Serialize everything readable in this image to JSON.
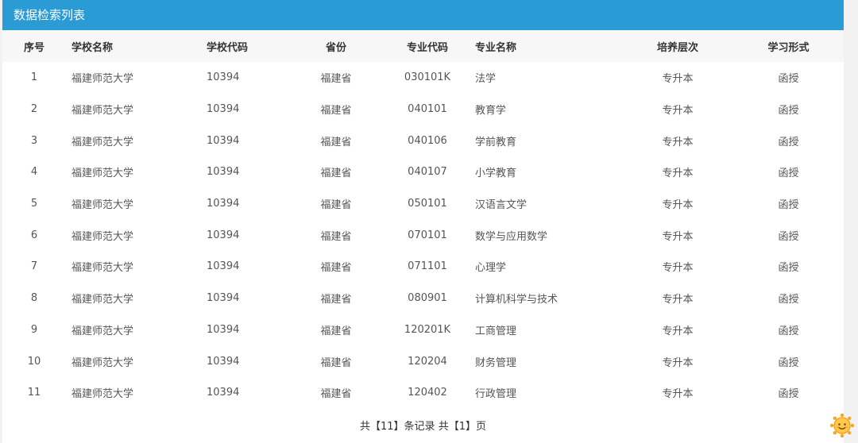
{
  "header": {
    "title": "数据检索列表"
  },
  "table": {
    "columns": [
      "序号",
      "学校名称",
      "学校代码",
      "省份",
      "专业代码",
      "专业名称",
      "培养层次",
      "学习形式"
    ],
    "rows": [
      [
        "1",
        "福建师范大学",
        "10394",
        "福建省",
        "030101K",
        "法学",
        "专升本",
        "函授"
      ],
      [
        "2",
        "福建师范大学",
        "10394",
        "福建省",
        "040101",
        "教育学",
        "专升本",
        "函授"
      ],
      [
        "3",
        "福建师范大学",
        "10394",
        "福建省",
        "040106",
        "学前教育",
        "专升本",
        "函授"
      ],
      [
        "4",
        "福建师范大学",
        "10394",
        "福建省",
        "040107",
        "小学教育",
        "专升本",
        "函授"
      ],
      [
        "5",
        "福建师范大学",
        "10394",
        "福建省",
        "050101",
        "汉语言文学",
        "专升本",
        "函授"
      ],
      [
        "6",
        "福建师范大学",
        "10394",
        "福建省",
        "070101",
        "数学与应用数学",
        "专升本",
        "函授"
      ],
      [
        "7",
        "福建师范大学",
        "10394",
        "福建省",
        "071101",
        "心理学",
        "专升本",
        "函授"
      ],
      [
        "8",
        "福建师范大学",
        "10394",
        "福建省",
        "080901",
        "计算机科学与技术",
        "专升本",
        "函授"
      ],
      [
        "9",
        "福建师范大学",
        "10394",
        "福建省",
        "120201K",
        "工商管理",
        "专升本",
        "函授"
      ],
      [
        "10",
        "福建师范大学",
        "10394",
        "福建省",
        "120204",
        "财务管理",
        "专升本",
        "函授"
      ],
      [
        "11",
        "福建师范大学",
        "10394",
        "福建省",
        "120402",
        "行政管理",
        "专升本",
        "函授"
      ]
    ]
  },
  "pager": {
    "text": "共【11】条记录 共【1】页"
  },
  "colors": {
    "header_bg": "#2b9bd6",
    "header_text": "#ffffff"
  },
  "icons": {
    "corner": "sun-face-icon"
  }
}
